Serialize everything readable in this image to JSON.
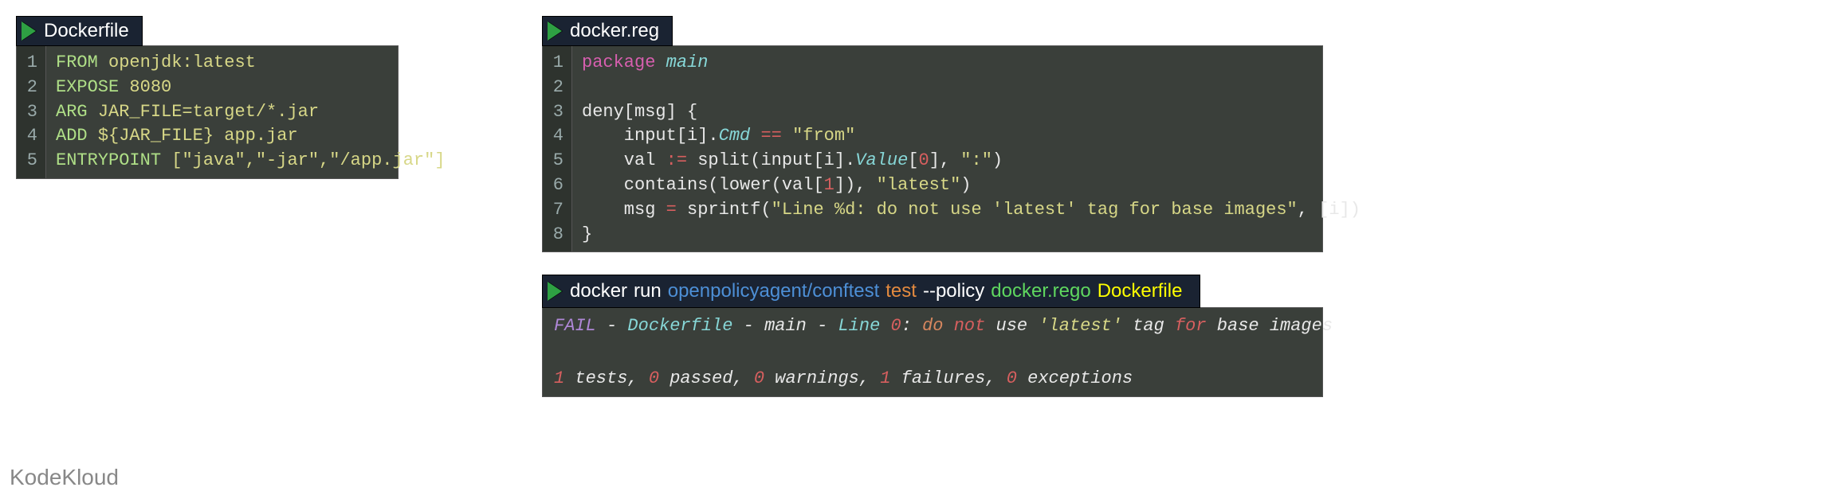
{
  "brand": "KodeKloud",
  "dockerfile": {
    "tab_label": "Dockerfile",
    "lines": [
      {
        "n": "1",
        "tokens": [
          {
            "t": "FROM",
            "c": "kw-green"
          },
          {
            "t": " ",
            "c": "kw-text"
          },
          {
            "t": "openjdk:latest",
            "c": "kw-yellow"
          }
        ]
      },
      {
        "n": "2",
        "tokens": [
          {
            "t": "EXPOSE",
            "c": "kw-green"
          },
          {
            "t": " ",
            "c": "kw-text"
          },
          {
            "t": "8080",
            "c": "kw-yellow"
          }
        ]
      },
      {
        "n": "3",
        "tokens": [
          {
            "t": "ARG",
            "c": "kw-green"
          },
          {
            "t": " ",
            "c": "kw-text"
          },
          {
            "t": "JAR_FILE=target/*.jar",
            "c": "kw-yellow"
          }
        ]
      },
      {
        "n": "4",
        "tokens": [
          {
            "t": "ADD",
            "c": "kw-green"
          },
          {
            "t": " ",
            "c": "kw-text"
          },
          {
            "t": "${JAR_FILE} app.jar",
            "c": "kw-yellow"
          }
        ]
      },
      {
        "n": "5",
        "tokens": [
          {
            "t": "ENTRYPOINT",
            "c": "kw-green"
          },
          {
            "t": " [",
            "c": "kw-yellow"
          },
          {
            "t": "\"java\"",
            "c": "kw-yellow"
          },
          {
            "t": ",",
            "c": "kw-yellow"
          },
          {
            "t": "\"-jar\"",
            "c": "kw-yellow"
          },
          {
            "t": ",",
            "c": "kw-yellow"
          },
          {
            "t": "\"/app.jar\"",
            "c": "kw-yellow"
          },
          {
            "t": "]",
            "c": "kw-yellow"
          }
        ]
      }
    ]
  },
  "rego": {
    "tab_label": "docker.reg",
    "lines": [
      {
        "n": "1",
        "tokens": [
          {
            "t": "package",
            "c": "kw-pink"
          },
          {
            "t": " ",
            "c": "kw-text"
          },
          {
            "t": "main",
            "c": "kw-cyan kw-italic"
          }
        ]
      },
      {
        "n": "2",
        "tokens": [
          {
            "t": "",
            "c": "kw-text"
          }
        ]
      },
      {
        "n": "3",
        "tokens": [
          {
            "t": "deny[msg] {",
            "c": "kw-text"
          }
        ]
      },
      {
        "n": "4",
        "tokens": [
          {
            "t": "    input[i].",
            "c": "kw-text"
          },
          {
            "t": "Cmd",
            "c": "kw-cyan kw-italic"
          },
          {
            "t": " ",
            "c": "kw-text"
          },
          {
            "t": "==",
            "c": "kw-red"
          },
          {
            "t": " ",
            "c": "kw-text"
          },
          {
            "t": "\"from\"",
            "c": "kw-yellow"
          }
        ]
      },
      {
        "n": "5",
        "tokens": [
          {
            "t": "    val ",
            "c": "kw-text"
          },
          {
            "t": ":=",
            "c": "kw-red"
          },
          {
            "t": " split(input[i].",
            "c": "kw-text"
          },
          {
            "t": "Value",
            "c": "kw-cyan kw-italic"
          },
          {
            "t": "[",
            "c": "kw-text"
          },
          {
            "t": "0",
            "c": "kw-red"
          },
          {
            "t": "], ",
            "c": "kw-text"
          },
          {
            "t": "\":\"",
            "c": "kw-yellow"
          },
          {
            "t": ")",
            "c": "kw-text"
          }
        ]
      },
      {
        "n": "6",
        "tokens": [
          {
            "t": "    contains(lower(val[",
            "c": "kw-text"
          },
          {
            "t": "1",
            "c": "kw-red"
          },
          {
            "t": "]), ",
            "c": "kw-text"
          },
          {
            "t": "\"latest\"",
            "c": "kw-yellow"
          },
          {
            "t": ")",
            "c": "kw-text"
          }
        ]
      },
      {
        "n": "7",
        "tokens": [
          {
            "t": "    msg ",
            "c": "kw-text"
          },
          {
            "t": "=",
            "c": "kw-red"
          },
          {
            "t": " sprintf(",
            "c": "kw-text"
          },
          {
            "t": "\"Line %d: do not use 'latest' tag for base images\"",
            "c": "kw-yellow"
          },
          {
            "t": ", [i])",
            "c": "kw-text"
          }
        ]
      },
      {
        "n": "8",
        "tokens": [
          {
            "t": "}",
            "c": "kw-text"
          }
        ]
      }
    ]
  },
  "command": {
    "parts": [
      {
        "t": "docker",
        "c": "cmd-white"
      },
      {
        "t": "run",
        "c": "cmd-white"
      },
      {
        "t": "openpolicyagent/conftest",
        "c": "cmd-blue"
      },
      {
        "t": "test",
        "c": "cmd-orange"
      },
      {
        "t": "--policy",
        "c": "cmd-white"
      },
      {
        "t": "docker.rego",
        "c": "cmd-green"
      },
      {
        "t": "Dockerfile",
        "c": "cmd-yellow"
      }
    ]
  },
  "output": {
    "lines": [
      {
        "tokens": [
          {
            "t": "FAIL",
            "c": "kw-purple"
          },
          {
            "t": " - ",
            "c": "kw-text"
          },
          {
            "t": "Dockerfile",
            "c": "kw-cyan"
          },
          {
            "t": " - ",
            "c": "kw-text"
          },
          {
            "t": "main",
            "c": "kw-text"
          },
          {
            "t": " - ",
            "c": "kw-text"
          },
          {
            "t": "Line",
            "c": "kw-cyan"
          },
          {
            "t": " ",
            "c": "kw-text"
          },
          {
            "t": "0",
            "c": "kw-red"
          },
          {
            "t": ": ",
            "c": "kw-text"
          },
          {
            "t": "do",
            "c": "kw-orange"
          },
          {
            "t": " ",
            "c": "kw-text"
          },
          {
            "t": "not",
            "c": "kw-red"
          },
          {
            "t": " ",
            "c": "kw-text"
          },
          {
            "t": "use",
            "c": "kw-text"
          },
          {
            "t": " ",
            "c": "kw-text"
          },
          {
            "t": "'latest'",
            "c": "kw-yellow"
          },
          {
            "t": " ",
            "c": "kw-text"
          },
          {
            "t": "tag",
            "c": "kw-text"
          },
          {
            "t": " ",
            "c": "kw-text"
          },
          {
            "t": "for",
            "c": "kw-red"
          },
          {
            "t": " ",
            "c": "kw-text"
          },
          {
            "t": "base",
            "c": "kw-text"
          },
          {
            "t": " ",
            "c": "kw-text"
          },
          {
            "t": "images",
            "c": "kw-text"
          }
        ]
      },
      {
        "tokens": [
          {
            "t": "",
            "c": "kw-text"
          }
        ]
      },
      {
        "tokens": [
          {
            "t": "1",
            "c": "kw-red"
          },
          {
            "t": " tests, ",
            "c": "kw-text"
          },
          {
            "t": "0",
            "c": "kw-red"
          },
          {
            "t": " passed, ",
            "c": "kw-text"
          },
          {
            "t": "0",
            "c": "kw-red"
          },
          {
            "t": " warnings, ",
            "c": "kw-text"
          },
          {
            "t": "1",
            "c": "kw-red"
          },
          {
            "t": " failures, ",
            "c": "kw-text"
          },
          {
            "t": "0",
            "c": "kw-red"
          },
          {
            "t": " exceptions",
            "c": "kw-text"
          }
        ]
      }
    ]
  }
}
